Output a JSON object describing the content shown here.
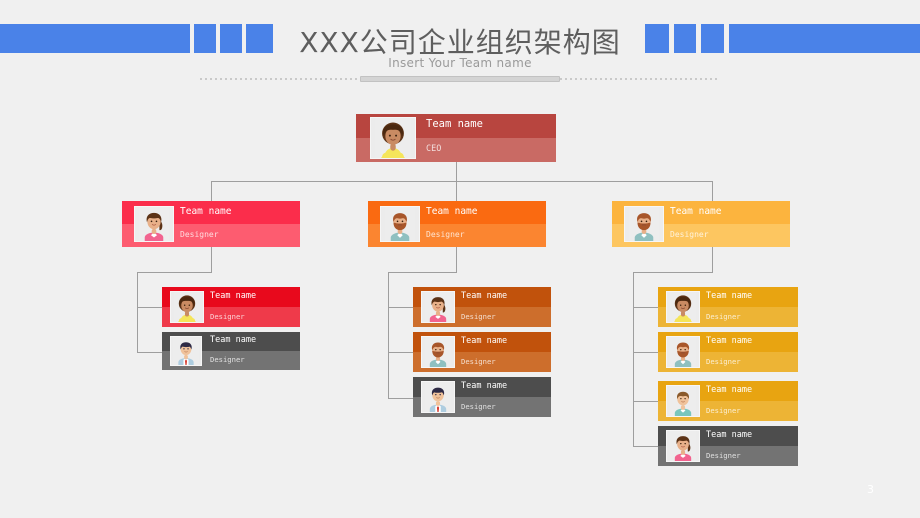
{
  "header": {
    "title": "XXX公司企业组织架构图",
    "subtitle": "Insert Your Team name",
    "accent_color": "#4a82e8",
    "decorations": {
      "left_bar": "blue-bar",
      "left_squares": [
        "blue-square",
        "blue-square",
        "blue-square"
      ],
      "right_squares": [
        "blue-square",
        "blue-square",
        "blue-square"
      ],
      "right_bar": "blue-bar"
    }
  },
  "chart_data": {
    "type": "diagram",
    "diagram_kind": "organization-chart",
    "title": "XXX公司企业组织架构图",
    "subtitle": "Insert Your Team name",
    "levels": 3,
    "nodes": [
      {
        "id": "ceo",
        "name": "Team name",
        "role": "CEO",
        "color": "#b8453f",
        "color_light": "#c96a64",
        "avatar": "woman-curly-hair-yellow-top",
        "level": 1,
        "parent": null
      },
      {
        "id": "b1",
        "name": "Team name",
        "role": "Designer",
        "color": "#fb2d4b",
        "color_light": "#fd5c70",
        "avatar": "woman-ponytail-pink-top",
        "level": 2,
        "parent": "ceo"
      },
      {
        "id": "b2",
        "name": "Team name",
        "role": "Designer",
        "color": "#fa6a11",
        "color_light": "#fb8530",
        "avatar": "man-beard-teal-shirt",
        "level": 2,
        "parent": "ceo"
      },
      {
        "id": "b3",
        "name": "Team name",
        "role": "Designer",
        "color": "#fcb43e",
        "color_light": "#fdc660",
        "avatar": "man-beard-teal-shirt",
        "level": 2,
        "parent": "ceo"
      },
      {
        "id": "b1c1",
        "name": "Team name",
        "role": "Designer",
        "color": "#e8091c",
        "color_light": "#ef3a4a",
        "avatar": "woman-curly-hair-yellow-top",
        "level": 3,
        "parent": "b1"
      },
      {
        "id": "b1c2",
        "name": "Team name",
        "role": "Designer",
        "color": "#4d4d4d",
        "color_light": "#737373",
        "avatar": "man-darkhair-tie",
        "level": 3,
        "parent": "b1"
      },
      {
        "id": "b2c1",
        "name": "Team name",
        "role": "Designer",
        "color": "#c1520c",
        "color_light": "#cd6e2c",
        "avatar": "woman-ponytail-pink-top",
        "level": 3,
        "parent": "b2"
      },
      {
        "id": "b2c2",
        "name": "Team name",
        "role": "Designer",
        "color": "#c1520c",
        "color_light": "#cd6e2c",
        "avatar": "man-beard-teal-shirt",
        "level": 3,
        "parent": "b2"
      },
      {
        "id": "b2c3",
        "name": "Team name",
        "role": "Designer",
        "color": "#4d4d4d",
        "color_light": "#737373",
        "avatar": "man-darkhair-tie",
        "level": 3,
        "parent": "b2"
      },
      {
        "id": "b3c1",
        "name": "Team name",
        "role": "Designer",
        "color": "#e8a411",
        "color_light": "#edb435",
        "avatar": "woman-curly-hair-yellow-top",
        "level": 3,
        "parent": "b3"
      },
      {
        "id": "b3c2",
        "name": "Team name",
        "role": "Designer",
        "color": "#e8a411",
        "color_light": "#edb435",
        "avatar": "man-beard-teal-shirt",
        "level": 3,
        "parent": "b3"
      },
      {
        "id": "b3c3",
        "name": "Team name",
        "role": "Designer",
        "color": "#e8a411",
        "color_light": "#edb435",
        "avatar": "boy-short-hair-teal-top",
        "level": 3,
        "parent": "b3"
      },
      {
        "id": "b3c4",
        "name": "Team name",
        "role": "Designer",
        "color": "#4d4d4d",
        "color_light": "#737373",
        "avatar": "woman-ponytail-pink-top",
        "level": 3,
        "parent": "b3"
      }
    ],
    "connector_color": "#9e9e9e"
  },
  "footer": {
    "page_number": "3"
  }
}
